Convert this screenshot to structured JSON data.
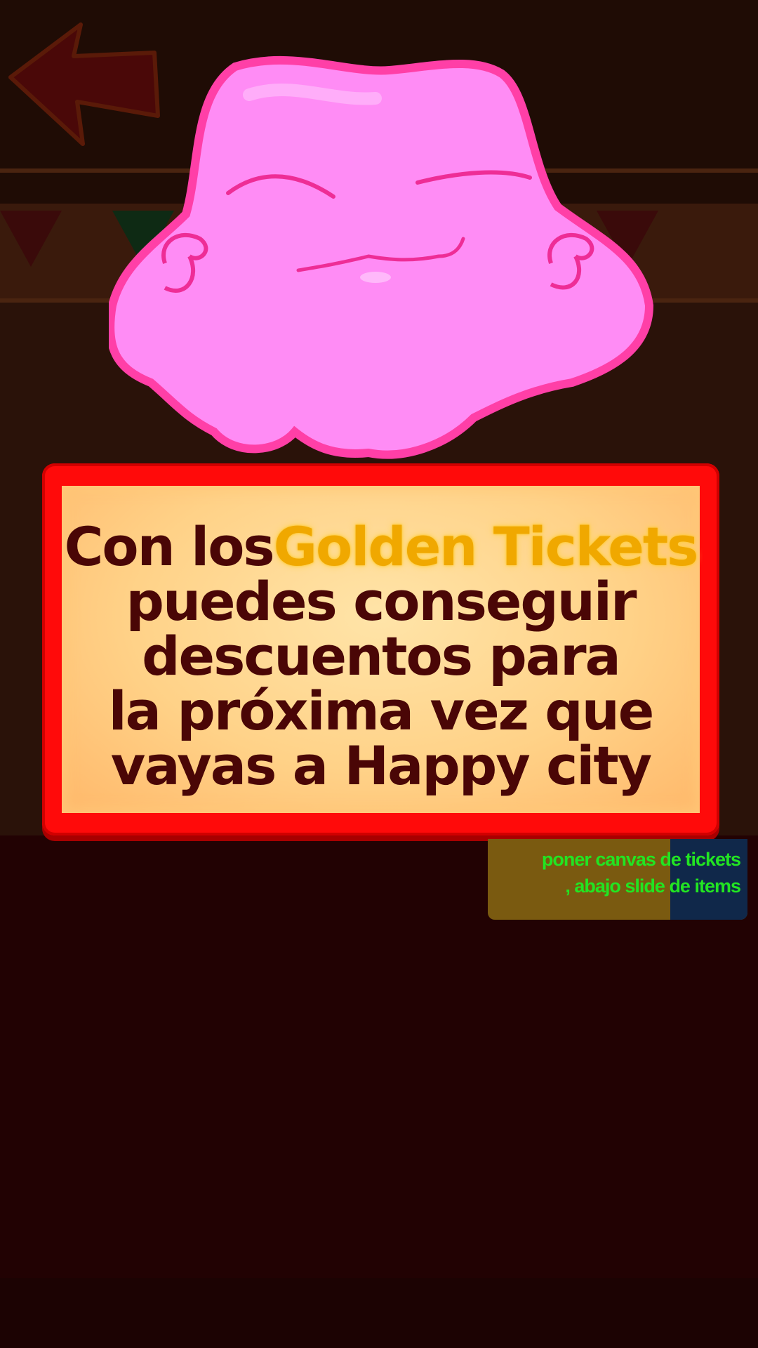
{
  "screen": {
    "background_color": "#230202",
    "panel_color": "#ff0a0a",
    "text_color": "#4a0606",
    "highlight_color": "#f0a800"
  },
  "back_button": {
    "icon": "arrow-left-icon"
  },
  "mascot": {
    "icon": "pink-blob-character"
  },
  "message": {
    "line1_prefix": "Con los",
    "line1_highlight": "Golden Tickets",
    "line2": "puedes conseguir",
    "line3": "descuentos para",
    "line4": "la próxima vez que",
    "line5": "vayas a Happy city"
  },
  "dev_note": {
    "line1": "poner canvas de tickets",
    "line2": ", abajo slide de items"
  }
}
